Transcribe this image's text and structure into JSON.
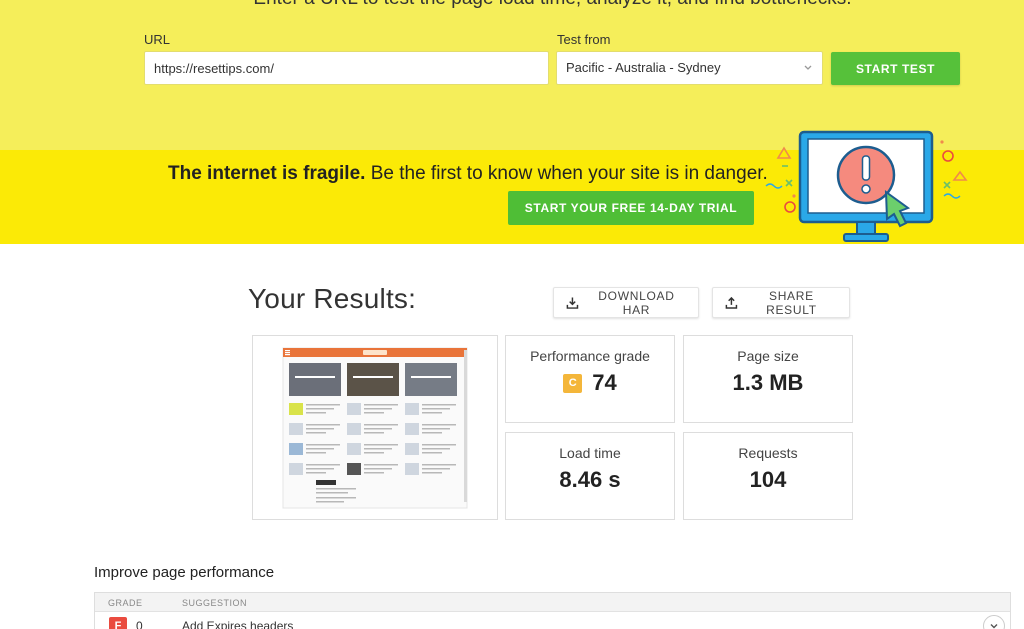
{
  "hero": {
    "tagline": "Enter a URL to test the page load time, analyze it, and find bottlenecks.",
    "url_label": "URL",
    "url_value": "https://resettips.com/",
    "location_label": "Test from",
    "location_value": "Pacific - Australia - Sydney",
    "start_button": "START TEST"
  },
  "banner": {
    "bold_text": "The internet is fragile.",
    "text": " Be the first to know when your site is in danger.",
    "trial_button": "START YOUR FREE 14-DAY TRIAL"
  },
  "results": {
    "title": "Your Results:",
    "download_har": "DOWNLOAD HAR",
    "share_result": "SHARE RESULT",
    "metrics": {
      "performance_label": "Performance grade",
      "performance_grade": "C",
      "performance_score": "74",
      "page_size_label": "Page size",
      "page_size_value": "1.3 MB",
      "load_time_label": "Load time",
      "load_time_value": "8.46 s",
      "requests_label": "Requests",
      "requests_value": "104"
    }
  },
  "improve": {
    "title": "Improve page performance",
    "col_grade": "GRADE",
    "col_suggestion": "SUGGESTION",
    "rows": [
      {
        "grade": "F",
        "score": "0",
        "suggestion": "Add Expires headers"
      }
    ]
  },
  "colors": {
    "hero_bg": "#f5ee5a",
    "banner_bg": "#fbea06",
    "button_green": "#56c13a",
    "grade_c": "#f4b63a",
    "grade_f": "#ea4b3f",
    "monitor_blue": "#2aa8e8"
  }
}
